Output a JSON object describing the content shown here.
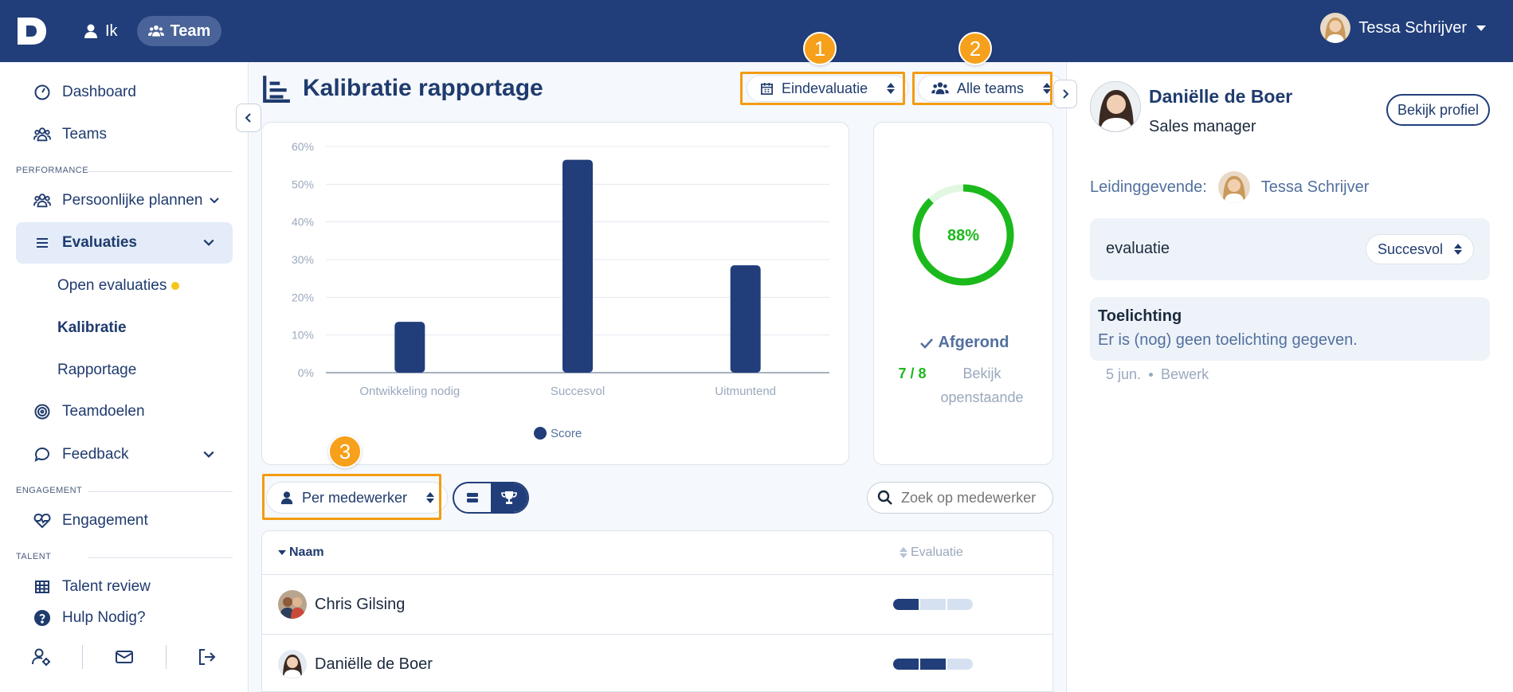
{
  "topbar": {
    "logo_letter": "D",
    "nav": [
      {
        "label": "Ik",
        "icon": "user-icon"
      },
      {
        "label": "Team",
        "icon": "users-icon"
      }
    ],
    "user_name": "Tessa Schrijver"
  },
  "sidebar": {
    "dashboard": "Dashboard",
    "teams": "Teams",
    "section_performance": "PERFORMANCE",
    "persoonlijke_plannen": "Persoonlijke plannen",
    "evaluaties": "Evaluaties",
    "open_evaluaties": "Open evaluaties",
    "kalibratie": "Kalibratie",
    "rapportage": "Rapportage",
    "teamdoelen": "Teamdoelen",
    "feedback": "Feedback",
    "section_engagement": "ENGAGEMENT",
    "engagement": "Engagement",
    "section_talent": "TALENT",
    "talent_review": "Talent review",
    "hulp": "Hulp Nodig?"
  },
  "main": {
    "title": "Kalibratie rapportage",
    "filter_evaluation": "Eindevaluatie",
    "filter_teams": "Alle teams",
    "badges": [
      "1",
      "2",
      "3"
    ],
    "group_by": "Per medewerker",
    "search_placeholder": "Zoek op medewerker",
    "completion": {
      "percent_label": "88%",
      "percent": 88,
      "status": "Afgerond",
      "count": "7 / 8",
      "open_link": "Bekijk openstaande"
    },
    "table": {
      "col_name": "Naam",
      "col_eval": "Evaluatie",
      "rows": [
        {
          "name": "Chris Gilsing",
          "level": 1
        },
        {
          "name": "Daniëlle de Boer",
          "level": 2
        }
      ]
    }
  },
  "chart_data": {
    "type": "bar",
    "categories": [
      "Ontwikkeling nodig",
      "Succesvol",
      "Uitmuntend"
    ],
    "series": [
      {
        "name": "Score",
        "values": [
          13.5,
          56.5,
          28.5
        ]
      }
    ],
    "ylim": [
      0,
      60
    ],
    "yticks": [
      "0%",
      "10%",
      "20%",
      "30%",
      "40%",
      "50%",
      "60%"
    ],
    "legend": "bottom",
    "bar_color": "#213e7a",
    "grid": true
  },
  "panel": {
    "name": "Daniëlle de Boer",
    "role": "Sales manager",
    "profile_button": "Bekijk profiel",
    "lead_label": "Leidinggevende:",
    "lead_name": "Tessa Schrijver",
    "eval_label": "evaluatie",
    "eval_value": "Succesvol",
    "note_title": "Toelichting",
    "note_text": "Er is (nog) geen toelichting gegeven.",
    "note_date": "5 jun.",
    "note_edit": "Bewerk"
  },
  "colors": {
    "primary": "#213e7a",
    "accent": "#f39c12",
    "success": "#1cb91c"
  }
}
